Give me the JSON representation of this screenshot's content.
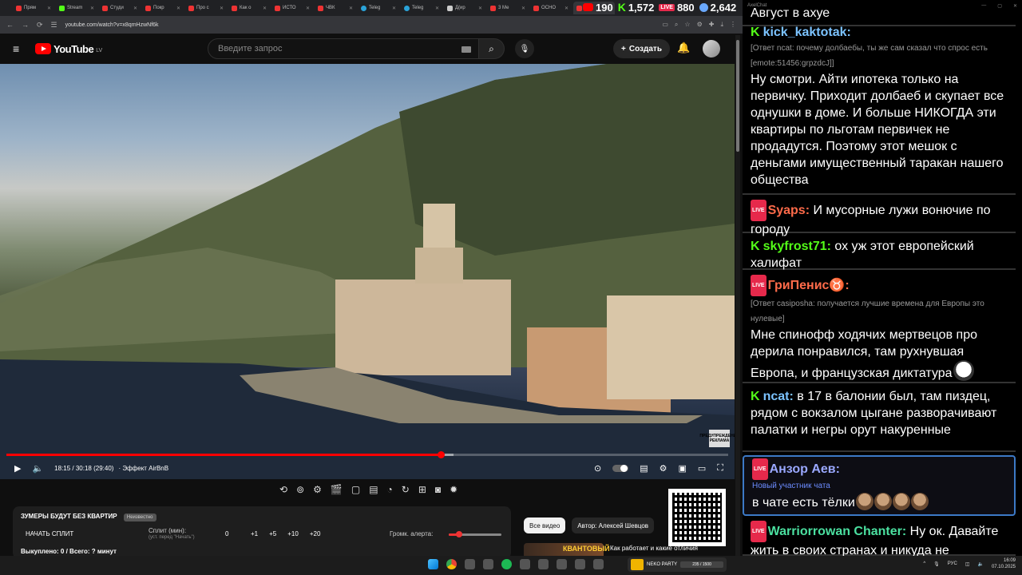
{
  "browser": {
    "tabs": [
      {
        "label": "Прям",
        "icon": "youtube-icon",
        "active": false
      },
      {
        "label": "Stream",
        "icon": "kick-icon",
        "active": false
      },
      {
        "label": "Студи",
        "icon": "youtube-icon",
        "active": false
      },
      {
        "label": "Покр",
        "icon": "youtube-icon",
        "active": false
      },
      {
        "label": "Про с",
        "icon": "youtube-icon",
        "active": false
      },
      {
        "label": "Как о",
        "icon": "youtube-icon",
        "active": false
      },
      {
        "label": "ИСТО",
        "icon": "youtube-icon",
        "active": false
      },
      {
        "label": "ЧВК",
        "icon": "youtube-icon",
        "active": false
      },
      {
        "label": "Teleg",
        "icon": "telegram-icon",
        "active": false
      },
      {
        "label": "Teleg",
        "icon": "telegram-icon",
        "active": false
      },
      {
        "label": "Д(ир",
        "icon": "app-icon",
        "active": false
      },
      {
        "label": "3 Ме",
        "icon": "youtube-icon",
        "active": false
      },
      {
        "label": "ОСНО",
        "icon": "youtube-icon",
        "active": false
      },
      {
        "label": "",
        "icon": "youtube-icon",
        "active": true
      }
    ],
    "url": "youtube.com/watch?v=x8qmHzwNf6k"
  },
  "counters": {
    "youtube": "190",
    "kick": "1,572",
    "vk": "880",
    "total": "2,642"
  },
  "youtube": {
    "logo_text": "YouTube",
    "country_code": "LV",
    "search_placeholder": "Введите запрос",
    "create_label": "Создать"
  },
  "player": {
    "time": "18:15 / 30:18 (29:40)",
    "chapter": "· Эффект AirBnB",
    "watermark": "ПРЕДУПРЕЖДЕНИЕ РЕКЛАМА",
    "progress_fraction": 0.602
  },
  "split_panel": {
    "title": "ЗУМЕРЫ БУДУТ БЕЗ КВАРТИР",
    "badge": "Неизвестно",
    "start_label": "НАЧАТЬ СПЛИТ",
    "split_label": "Сплит (мин):",
    "split_sub": "(уст. перед \"Начать\")",
    "value": "0",
    "buttons": [
      "+1",
      "+5",
      "+10",
      "+20"
    ],
    "volume_label": "Громк. алерта:",
    "volume_fraction": 0.2,
    "bought": "Выкуплено: 0 / Всего: ? минут"
  },
  "related": {
    "chips": [
      "Все видео",
      "Автор: Алексей Шевцов"
    ],
    "thumb_text": "КВАНТОВЫЙ",
    "title": "Как работает и какие отличия"
  },
  "chat": {
    "app_title": "AxelChat",
    "top_line": "Август в ахуе",
    "messages": [
      {
        "platform": "kick",
        "user": "kick_kaktotak:",
        "color": "#7cc3ff",
        "reply": "[Ответ ncat: почему долбаебы, ты же сам сказал что спрос есть [emote:51456:grpzdcJ]]",
        "text": "Ну смотри. Айти ипотека только на первичку. Приходит долбаеб и скупает все однушки в доме. И больше НИКОГДА эти квартиры по льготам первичек не продадутся. Поэтому этот мешок с деньгами имущественный таракан нашего общества"
      },
      {
        "platform": "vk",
        "user": "Syaps:",
        "color": "#ff6b4a",
        "text": "И мусорные лужи вонючие по городу"
      },
      {
        "platform": "kick",
        "user": "skyfrost71:",
        "color": "#53fc18",
        "text": "ох уж этот европейский халифат"
      },
      {
        "platform": "vk",
        "user": "ГриПенис♉:",
        "color": "#ff6b4a",
        "reply": "[Ответ casiposha: получается лучшие времена для Европы это нулевые]",
        "text": "Мне спинофф ходячих мертвецов про дерила понравился, там рухнувшая Европа, и французская диктатура"
      },
      {
        "platform": "kick",
        "user": "ncat:",
        "color": "#7cc3ff",
        "text": "в 17 в балонии был, там пиздец, рядом с вокзалом цыгане разворачивают палатки и негры орут накуренные"
      },
      {
        "platform": "vk",
        "user": "Анзор Аев:",
        "color": "#9aa8ff",
        "newbie": "Новый участник чата",
        "text": "в чате есть тёлки"
      },
      {
        "platform": "vk",
        "user": "Warriorrowan Chanter:",
        "color": "#4be0a0",
        "text": "Ну ок. Давайте жить в своих странах и никуда не"
      }
    ]
  },
  "taskbar": {
    "widget_text": "NEKO PARTY",
    "widget_counter": "235 / 1500",
    "lang": "РУС",
    "time": "16:09",
    "date": "07.10.2025"
  }
}
